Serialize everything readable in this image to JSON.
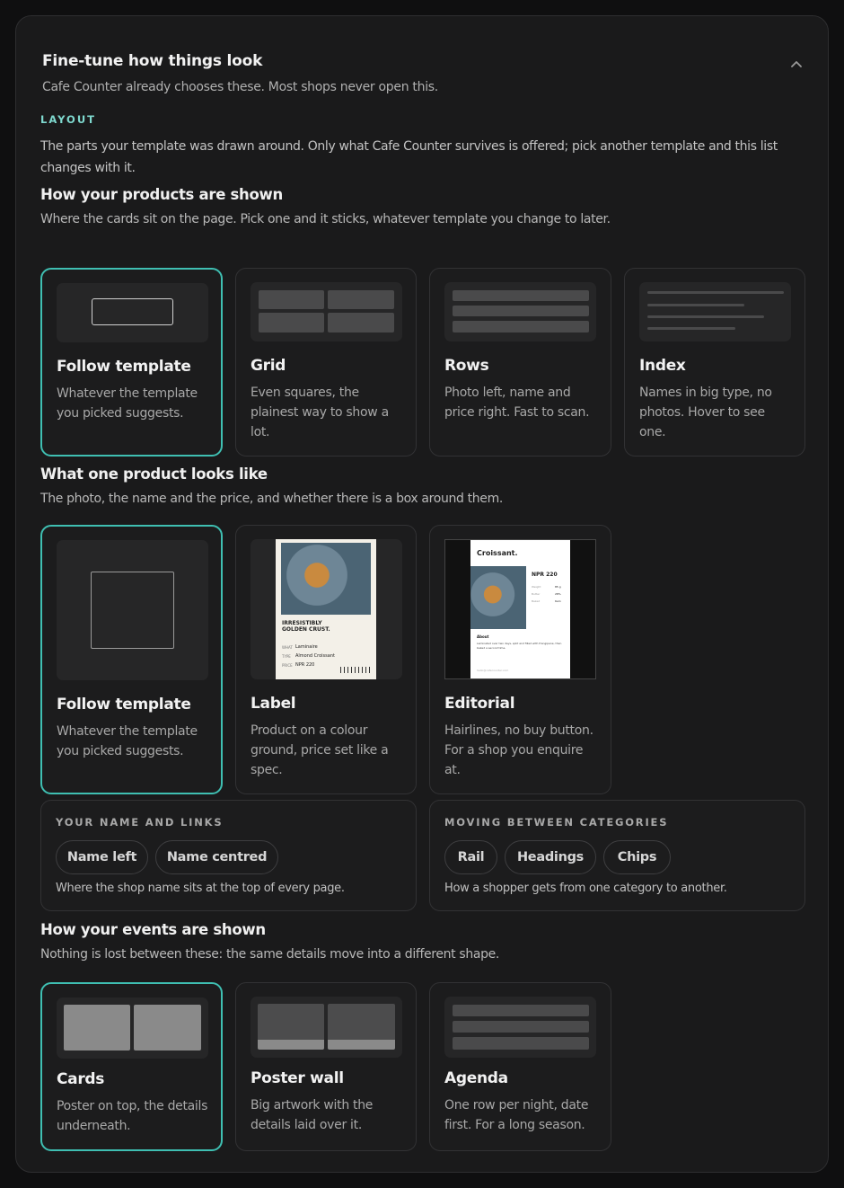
{
  "header": {
    "title": "Fine-tune how things look",
    "subtitle": "Cafe Counter already chooses these. Most shops never open this."
  },
  "layout": {
    "tag": "LAYOUT",
    "description": "The parts your template was drawn around. Only what Cafe Counter survives is offered; pick another template and this list changes with it."
  },
  "products": {
    "heading": "How your products are shown",
    "description": "Where the cards sit on the page. Pick one and it sticks, whatever template you change to later.",
    "options": [
      {
        "name": "Follow template",
        "desc": "Whatever the template you picked suggests.",
        "selected": true
      },
      {
        "name": "Grid",
        "desc": "Even squares, the plainest way to show a lot.",
        "selected": false
      },
      {
        "name": "Rows",
        "desc": "Photo left, name and price right. Fast to scan.",
        "selected": false
      },
      {
        "name": "Index",
        "desc": "Names in big type, no photos. Hover to see one.",
        "selected": false
      }
    ]
  },
  "product_look": {
    "heading": "What one product looks like",
    "description": "The photo, the name and the price, and whether there is a box around them.",
    "options": [
      {
        "name": "Follow template",
        "desc": "Whatever the template you picked suggests.",
        "selected": true
      },
      {
        "name": "Label",
        "desc": "Product on a colour ground, price set like a spec.",
        "selected": false
      },
      {
        "name": "Editorial",
        "desc": "Hairlines, no buy button. For a shop you enquire at.",
        "selected": false
      }
    ],
    "label_art": {
      "headline1": "IRRESISTIBLY",
      "headline2": "GOLDEN CRUST.",
      "row1_key": "WHAT",
      "row1_val": "Laminaire",
      "row2_key": "TYPE",
      "row2_val": "Almond Croissant",
      "row3_key": "PRICE",
      "row3_val": "NPR 220"
    },
    "editorial_art": {
      "title": "Croissant.",
      "price": "NPR 220",
      "spec1_key": "Weight",
      "spec1_val": "85 g",
      "spec2_key": "Butter",
      "spec2_val": "28%",
      "spec3_key": "Baked",
      "spec3_val": "6am",
      "about_title": "About",
      "about_text": "Laminated over two days, split and filled with frangipane, then baked a second time.",
      "footer": "hello@cafecounter.com"
    }
  },
  "name_links": {
    "tag": "YOUR NAME AND LINKS",
    "chips": [
      "Name left",
      "Name centred"
    ],
    "note": "Where the shop name sits at the top of every page."
  },
  "categories": {
    "tag": "MOVING BETWEEN CATEGORIES",
    "chips": [
      "Rail",
      "Headings",
      "Chips"
    ],
    "note": "How a shopper gets from one category to another."
  },
  "events": {
    "heading": "How your events are shown",
    "description": "Nothing is lost between these: the same details move into a different shape.",
    "options": [
      {
        "name": "Cards",
        "desc": "Poster on top, the details underneath.",
        "selected": true
      },
      {
        "name": "Poster wall",
        "desc": "Big artwork with the details laid over it.",
        "selected": false
      },
      {
        "name": "Agenda",
        "desc": "One row per night, date first. For a long season.",
        "selected": false
      }
    ]
  },
  "colors": {
    "accent": "#3fbfb2",
    "section_tag": "#7fd9cf",
    "panel": "#1a1a1b",
    "background": "#0f0f10"
  }
}
